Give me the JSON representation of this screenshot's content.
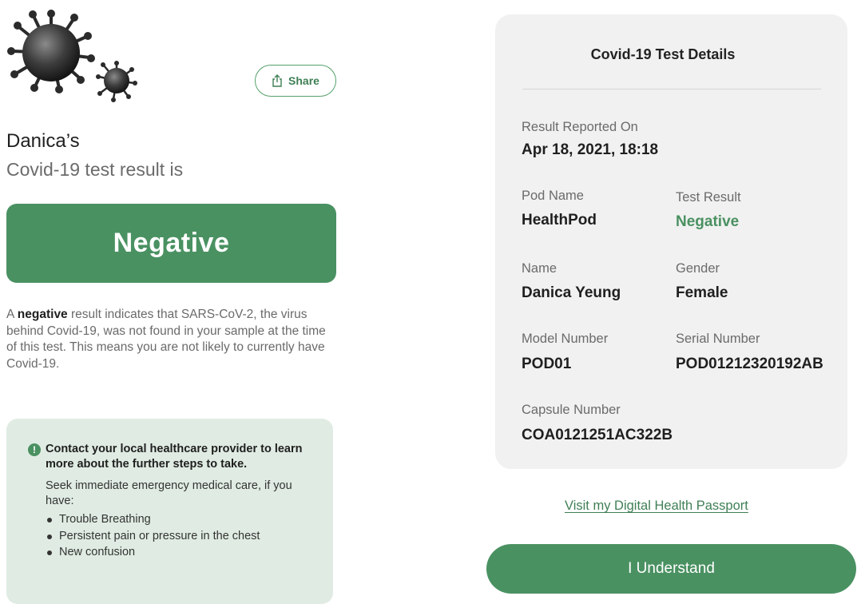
{
  "header": {
    "illustration_icon": "virus-icon",
    "share": {
      "label": "Share",
      "icon": "share-icon"
    }
  },
  "summary": {
    "owner": "Danica’s",
    "subtitle": "Covid-19 test result is",
    "result": "Negative",
    "result_color": "#4a9162"
  },
  "explanation": {
    "prefix": "A ",
    "emphasis": "negative",
    "rest": " result indicates that SARS-CoV-2, the virus behind Covid-19, was not found in your sample at the time of this test. This means you are not likely to currently have Covid-19."
  },
  "advice": {
    "icon": "alert-icon",
    "heading": "Contact your local healthcare provider to learn more about the further steps to take.",
    "body": "Seek immediate emergency medical care, if you have:",
    "symptoms": [
      "Trouble Breathing",
      "Persistent pain or pressure in the chest",
      "New confusion"
    ]
  },
  "details": {
    "title": "Covid-19 Test Details",
    "reported_label": "Result Reported On",
    "reported_value": "Apr 18, 2021, 18:18",
    "pod_label": "Pod Name",
    "pod_value": "HealthPod",
    "result_label": "Test Result",
    "result_value": "Negative",
    "name_label": "Name",
    "name_value": "Danica Yeung",
    "gender_label": "Gender",
    "gender_value": "Female",
    "model_label": "Model Number",
    "model_value": "POD01",
    "serial_label": "Serial Number",
    "serial_value": "POD01212320192AB",
    "capsule_label": "Capsule Number",
    "capsule_value": "COA0121251AC322B"
  },
  "actions": {
    "passport_link": "Visit my Digital Health Passport",
    "understand": "I Understand"
  }
}
